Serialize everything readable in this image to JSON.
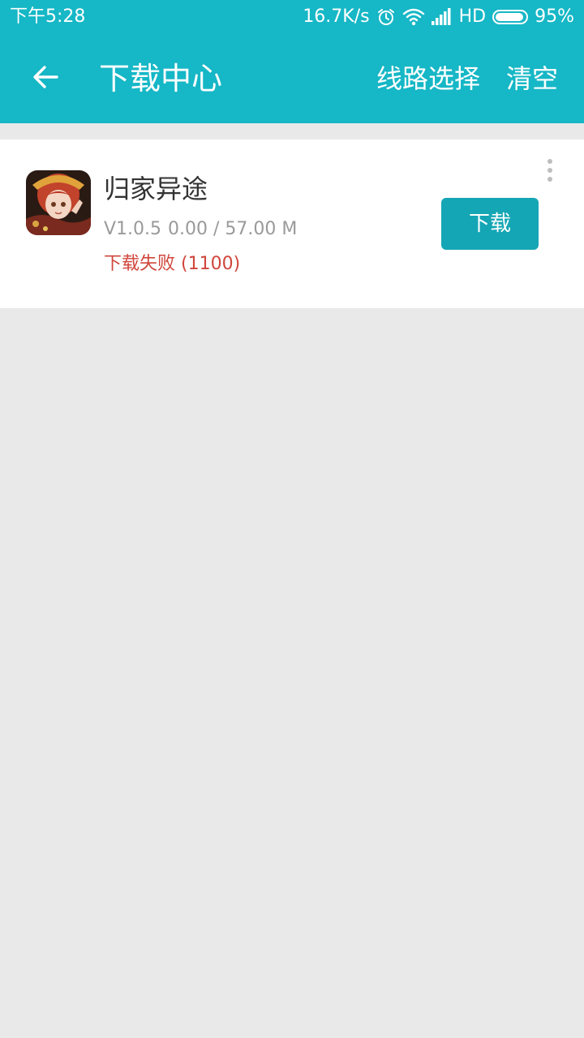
{
  "status_bar": {
    "time": "下午5:28",
    "network_speed": "16.7K/s",
    "network_type": "HD",
    "battery_percent": "95%",
    "battery_level": 0.95,
    "icons": [
      "alarm-icon",
      "wifi-icon",
      "signal-icon",
      "battery-icon"
    ]
  },
  "app_bar": {
    "title": "下载中心",
    "back_icon": "arrow-left-icon",
    "actions": {
      "route_select": "线路选择",
      "clear": "清空"
    }
  },
  "downloads": [
    {
      "name": "归家异途",
      "version": "V1.0.5",
      "progress": "0.00 / 57.00 M",
      "status": "下载失败 (1100)",
      "button_label": "下载",
      "icon": "game-avatar-icon",
      "menu_icon": "more-vertical-icon"
    }
  ],
  "colors": {
    "primary": "#16b7c6",
    "button": "#15a6b5",
    "error": "#d0463c",
    "background": "#e9e9e9"
  }
}
